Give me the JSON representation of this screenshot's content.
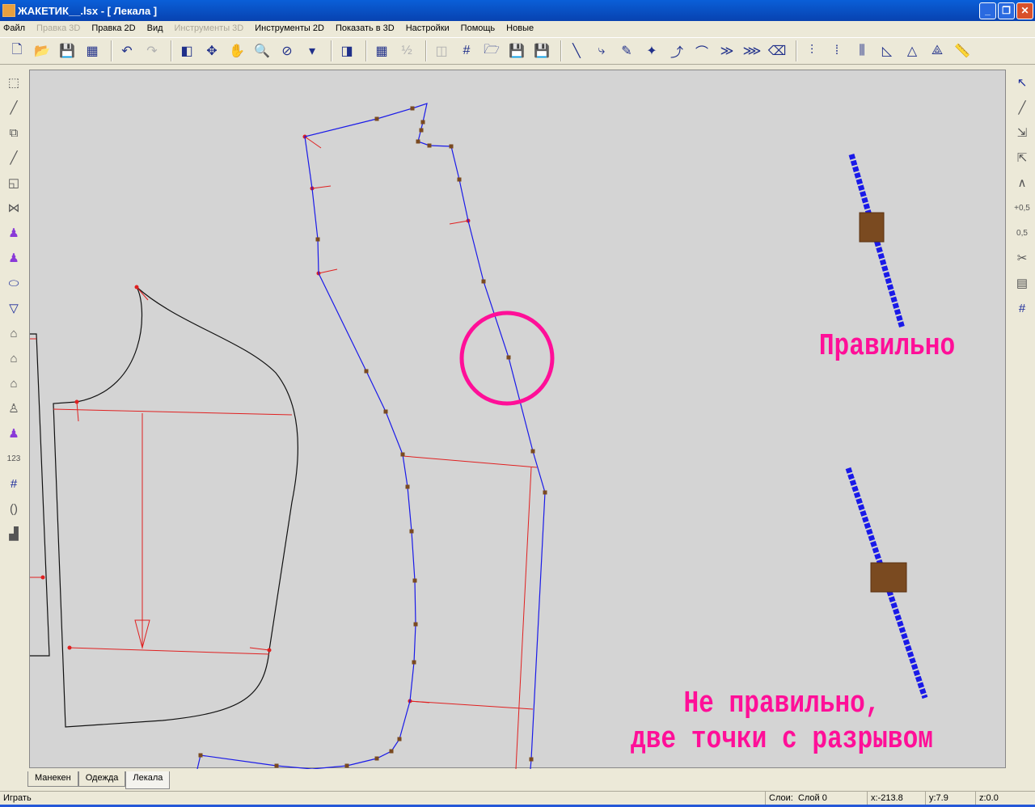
{
  "window": {
    "title": "ЖАКЕТИК__.lsx - [  Лекала  ]",
    "buttons": [
      "_",
      "❐",
      "✕"
    ]
  },
  "menu": [
    {
      "label": "Файл",
      "enabled": true
    },
    {
      "label": "Правка 3D",
      "enabled": false
    },
    {
      "label": "Правка 2D",
      "enabled": true
    },
    {
      "label": "Вид",
      "enabled": true
    },
    {
      "label": "Инструменты 3D",
      "enabled": false
    },
    {
      "label": "Инструменты 2D",
      "enabled": true
    },
    {
      "label": "Показать в 3D",
      "enabled": true
    },
    {
      "label": "Настройки",
      "enabled": true
    },
    {
      "label": "Помощь",
      "enabled": true
    },
    {
      "label": "Новые",
      "enabled": true
    }
  ],
  "toolbar": [
    {
      "name": "new-icon",
      "glyph": "🗋"
    },
    {
      "name": "open-icon",
      "glyph": "📂"
    },
    {
      "name": "save-icon",
      "glyph": "💾"
    },
    {
      "name": "save-all-icon",
      "glyph": "▦"
    },
    "sep",
    {
      "name": "undo-icon",
      "glyph": "↶"
    },
    {
      "name": "redo-icon",
      "glyph": "↷",
      "disabled": true
    },
    "sep",
    {
      "name": "panel-icon",
      "glyph": "◧"
    },
    {
      "name": "rotate-icon",
      "glyph": "✥"
    },
    {
      "name": "hand-icon",
      "glyph": "✋"
    },
    {
      "name": "zoom-icon",
      "glyph": "🔍"
    },
    {
      "name": "zoom-fit-icon",
      "glyph": "⊘"
    },
    {
      "name": "view-dropdown-icon",
      "glyph": "▾"
    },
    "sep",
    {
      "name": "texture-icon",
      "glyph": "◨"
    },
    "sep",
    {
      "name": "color-grid-icon",
      "glyph": "▦"
    },
    {
      "name": "fractions-icon",
      "glyph": "½",
      "disabled": true
    },
    "sep",
    {
      "name": "map-icon",
      "glyph": "◫",
      "disabled": true
    },
    {
      "name": "grid-icon",
      "glyph": "#"
    },
    {
      "name": "tp-open-icon",
      "glyph": "🗁"
    },
    {
      "name": "tp-save-icon",
      "glyph": "💾"
    },
    {
      "name": "tp-save-as-icon",
      "glyph": "💾"
    },
    "sep",
    {
      "name": "line-icon",
      "glyph": "╲"
    },
    {
      "name": "curve-icon",
      "glyph": "⤷"
    },
    {
      "name": "pencil-icon",
      "glyph": "✎"
    },
    {
      "name": "point-icon",
      "glyph": "✦"
    },
    {
      "name": "add-point-icon",
      "glyph": "⤴"
    },
    {
      "name": "bezier-icon",
      "glyph": "⌒"
    },
    {
      "name": "move-points-icon",
      "glyph": "≫"
    },
    {
      "name": "points-icon",
      "glyph": "⋙"
    },
    {
      "name": "eraser-icon",
      "glyph": "⌫"
    },
    "sep",
    {
      "name": "align-icon",
      "glyph": "⫶"
    },
    {
      "name": "distribute-icon",
      "glyph": "⁞"
    },
    {
      "name": "spacing-icon",
      "glyph": "⫼"
    },
    {
      "name": "measure-icon",
      "glyph": "◺"
    },
    {
      "name": "triangle-icon",
      "glyph": "△"
    },
    {
      "name": "triangle-alt-icon",
      "glyph": "⟁"
    },
    {
      "name": "ruler-icon",
      "glyph": "📏"
    }
  ],
  "left_toolbar": [
    {
      "name": "select-piece-icon",
      "glyph": "⬚"
    },
    {
      "name": "brush-icon",
      "glyph": "╱"
    },
    {
      "name": "copy-piece-icon",
      "glyph": "⧉"
    },
    {
      "name": "pin-icon",
      "glyph": "╱"
    },
    {
      "name": "piece-tool-icon",
      "glyph": "◱"
    },
    {
      "name": "mirror-icon",
      "glyph": "⋈"
    },
    {
      "name": "mannequin-torso-icon",
      "glyph": "♟",
      "color": "purple"
    },
    {
      "name": "mannequin-jacket-icon",
      "glyph": "♟",
      "color": "purple"
    },
    {
      "name": "ellipse-icon",
      "glyph": "⬭",
      "color": "blue"
    },
    {
      "name": "collar-icon",
      "glyph": "▽",
      "color": "blue"
    },
    {
      "name": "pants-icon",
      "glyph": "⌂"
    },
    {
      "name": "pants-alt-icon",
      "glyph": "⌂"
    },
    {
      "name": "figure-icon",
      "glyph": "⌂"
    },
    {
      "name": "dress-form-icon",
      "glyph": "♙"
    },
    {
      "name": "body-icon",
      "glyph": "♟",
      "color": "purple"
    },
    {
      "name": "numbering-icon",
      "glyph": "123"
    },
    {
      "name": "grid-icon",
      "glyph": "#",
      "color": "blue"
    },
    {
      "name": "bracket-icon",
      "glyph": "()"
    },
    {
      "name": "stamp-icon",
      "glyph": "▟"
    }
  ],
  "right_toolbar": [
    {
      "name": "cursor-icon",
      "glyph": "↖",
      "color": "blue"
    },
    {
      "name": "line-tool-icon",
      "glyph": "╱"
    },
    {
      "name": "scale-x-icon",
      "glyph": "⇲"
    },
    {
      "name": "scale-y-icon",
      "glyph": "⇱"
    },
    {
      "name": "measure-angle-icon",
      "glyph": "∧"
    },
    {
      "name": "plus-half-icon",
      "glyph": "+0,5"
    },
    {
      "name": "change-half-icon",
      "glyph": "0,5"
    },
    {
      "name": "cut-half-icon",
      "glyph": "✂"
    },
    {
      "name": "layers-icon",
      "glyph": "▤"
    },
    {
      "name": "grid-icon",
      "glyph": "#",
      "color": "blue"
    }
  ],
  "tabs": [
    {
      "label": "Манекен",
      "active": false
    },
    {
      "label": "Одежда",
      "active": false
    },
    {
      "label": "Лекала",
      "active": true
    }
  ],
  "status": {
    "left": "Играть",
    "layers_label": "Слои:",
    "layer": "Слой 0",
    "x": "x:-213.8",
    "y": "y:7.9",
    "z": "z:0.0"
  },
  "annotations": {
    "correct": "Правильно",
    "incorrect_line1": "Не правильно,",
    "incorrect_line2": "две точки с разрывом"
  },
  "colors": {
    "pattern_line": "#1a1ae8",
    "construction": "#e02020",
    "highlight": "#ff0f98",
    "point": "#7a4a20",
    "canvas": "#d4d4d4"
  }
}
